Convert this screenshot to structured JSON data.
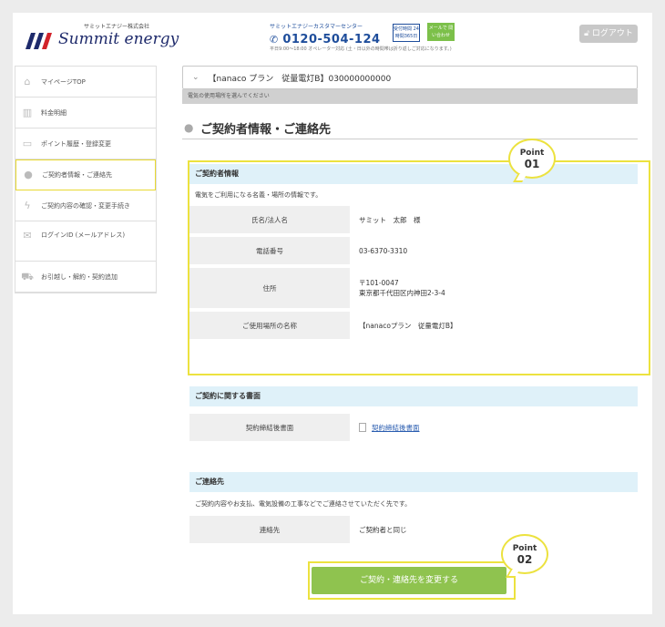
{
  "header": {
    "logo_kana": "サミットエナジー株式会社",
    "logo_text": "Summit energy",
    "cs_label": "サミットエナジーカスタマーセンター",
    "cs_phone": "0120-504-124",
    "cs_hours": "平日9:00〜18:00 オペレーター対応 (土・日以外の時間帯は折り返しご対応になります。)",
    "badge_outline": "受付時間 24時間365日",
    "badge_green": "メールで 問い合わせ",
    "logout_label": "ログアウト"
  },
  "sidebar": {
    "items": [
      {
        "label": "マイページTOP",
        "icon": "home-icon"
      },
      {
        "label": "料金明細",
        "icon": "bar-chart-icon"
      },
      {
        "label": "ポイント履歴・登録変更",
        "icon": "card-icon"
      },
      {
        "label": "ご契約者情報・ご連絡先",
        "icon": "person-icon"
      },
      {
        "label": "ご契約内容の確認・変更手続き",
        "icon": "bolt-icon"
      },
      {
        "label": "ログインID (メールアドレス)",
        "icon": "mail-icon"
      },
      {
        "label": "お引越し・解約・契約追加",
        "icon": "truck-icon"
      }
    ]
  },
  "main": {
    "selector_value": "【nanaco プラン　従量電灯B】030000000000",
    "selector_hint": "電気の使用場所を選んでください",
    "page_title": "ご契約者情報・ご連絡先",
    "contractor": {
      "heading": "ご契約者情報",
      "description": "電気をご利用になる名義・場所の情報です。",
      "rows": [
        {
          "label": "氏名/法人名",
          "value": "サミット　太郎　様"
        },
        {
          "label": "電話番号",
          "value": "03-6370-3310"
        },
        {
          "label": "住所",
          "value": "〒101-0047",
          "value2": "東京都千代田区内神田2-3-4"
        },
        {
          "label": "ご使用場所の名称",
          "value": "【nanacoプラン　従量電灯B】"
        }
      ]
    },
    "documents": {
      "heading": "ご契約に関する書面",
      "label": "契約締結後書面",
      "link": "契約締結後書面"
    },
    "contact": {
      "heading": "ご連絡先",
      "description": "ご契約内容やお支払、電気設備の工事などでご連絡させていただく先です。",
      "label": "連絡先",
      "value": "ご契約者と同じ"
    },
    "cta_label": "ご契約・連絡先を変更する"
  },
  "annotations": {
    "point1": {
      "title": "Point",
      "num": "01"
    },
    "point2": {
      "title": "Point",
      "num": "02"
    }
  },
  "colors": {
    "accent_yellow": "#ece23f",
    "cta_green": "#8fc34f",
    "section_blue": "#dff1f9",
    "brand_navy": "#1e2a6b"
  }
}
